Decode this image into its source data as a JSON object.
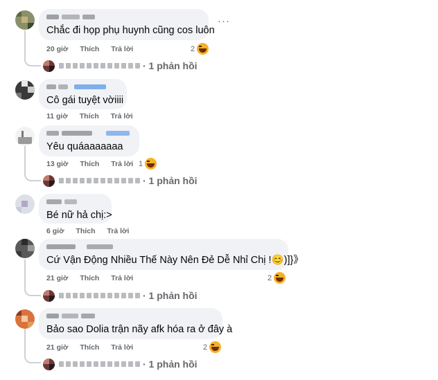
{
  "actions": {
    "like_label": "Thích",
    "reply_label": "Trả lời"
  },
  "more_icon": "more-horizontal-icon",
  "reaction_icon": "haha-emoji-icon",
  "comments": [
    {
      "text": "Chắc đi họp phụ huynh cũng cos luôn",
      "time": "20 giờ",
      "reactions": "2",
      "replies": "· 1 phản hồi"
    },
    {
      "text": "Cô gái tuyệt vờiiii",
      "time": "11 giờ"
    },
    {
      "text": "Yêu quáaaaaaaa",
      "time": "13 giờ",
      "reactions": "1",
      "replies": "· 1 phản hồi"
    },
    {
      "text": "Bé nữ hả chị:>",
      "time": "6 giờ"
    },
    {
      "text": "Cứ Vận Động Nhiều Thế Này Nên Đẻ Dễ Nhỉ Chị !😊)]}》",
      "time": "21 giờ",
      "reactions": "2",
      "replies": "· 1 phản hồi"
    },
    {
      "text": "Bảo sao Dolia trận nãy afk hóa ra ở đây à",
      "time": "21 giờ",
      "reactions": "2",
      "replies": "· 1 phản hồi"
    }
  ]
}
